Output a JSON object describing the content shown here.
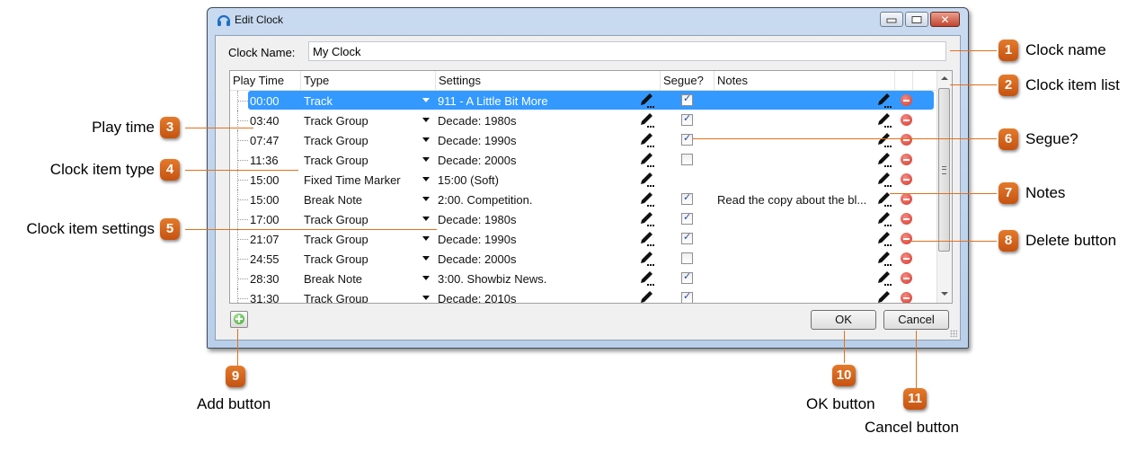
{
  "window": {
    "title": "Edit Clock",
    "icon": "headphones-icon",
    "controls": {
      "minimize": "minimize-icon",
      "maximize": "maximize-icon",
      "close": "✕"
    }
  },
  "clock_name": {
    "label": "Clock Name:",
    "value": "My Clock"
  },
  "grid": {
    "headers": [
      "Play Time",
      "Type",
      "Settings",
      "Segue?",
      "Notes"
    ],
    "rows": [
      {
        "time": "00:00",
        "type": "Track",
        "settings": "911 - A Little Bit More",
        "segue": true,
        "notes": "",
        "selected": true
      },
      {
        "time": "03:40",
        "type": "Track Group",
        "settings": "Decade: 1980s",
        "segue": true,
        "notes": ""
      },
      {
        "time": "07:47",
        "type": "Track Group",
        "settings": "Decade: 1990s",
        "segue": true,
        "notes": ""
      },
      {
        "time": "11:36",
        "type": "Track Group",
        "settings": "Decade: 2000s",
        "segue": false,
        "notes": ""
      },
      {
        "time": "15:00",
        "type": "Fixed Time Marker",
        "settings": "15:00 (Soft)",
        "segue": null,
        "notes": ""
      },
      {
        "time": "15:00",
        "type": "Break Note",
        "settings": "2:00. Competition.",
        "segue": true,
        "notes": "Read the copy about the bl..."
      },
      {
        "time": "17:00",
        "type": "Track Group",
        "settings": "Decade: 1980s",
        "segue": true,
        "notes": ""
      },
      {
        "time": "21:07",
        "type": "Track Group",
        "settings": "Decade: 1990s",
        "segue": true,
        "notes": ""
      },
      {
        "time": "24:55",
        "type": "Track Group",
        "settings": "Decade: 2000s",
        "segue": false,
        "notes": ""
      },
      {
        "time": "28:30",
        "type": "Break Note",
        "settings": "3:00. Showbiz News.",
        "segue": true,
        "notes": ""
      },
      {
        "time": "31:30",
        "type": "Track Group",
        "settings": "Decade: 2010s",
        "segue": true,
        "notes": ""
      }
    ]
  },
  "buttons": {
    "ok": "OK",
    "cancel": "Cancel",
    "add": "add-icon"
  },
  "callouts": [
    {
      "n": "1",
      "label": "Clock name"
    },
    {
      "n": "2",
      "label": "Clock item list"
    },
    {
      "n": "3",
      "label": "Play time"
    },
    {
      "n": "4",
      "label": "Clock item type"
    },
    {
      "n": "5",
      "label": "Clock item settings"
    },
    {
      "n": "6",
      "label": "Segue?"
    },
    {
      "n": "7",
      "label": "Notes"
    },
    {
      "n": "8",
      "label": "Delete button"
    },
    {
      "n": "9",
      "label": "Add button"
    },
    {
      "n": "10",
      "label": "OK button"
    },
    {
      "n": "11",
      "label": "Cancel button"
    }
  ],
  "colors": {
    "selection": "#3399ff",
    "callout": "#d9661e",
    "delete": "#e04a3c",
    "add": "#4cb43a"
  }
}
